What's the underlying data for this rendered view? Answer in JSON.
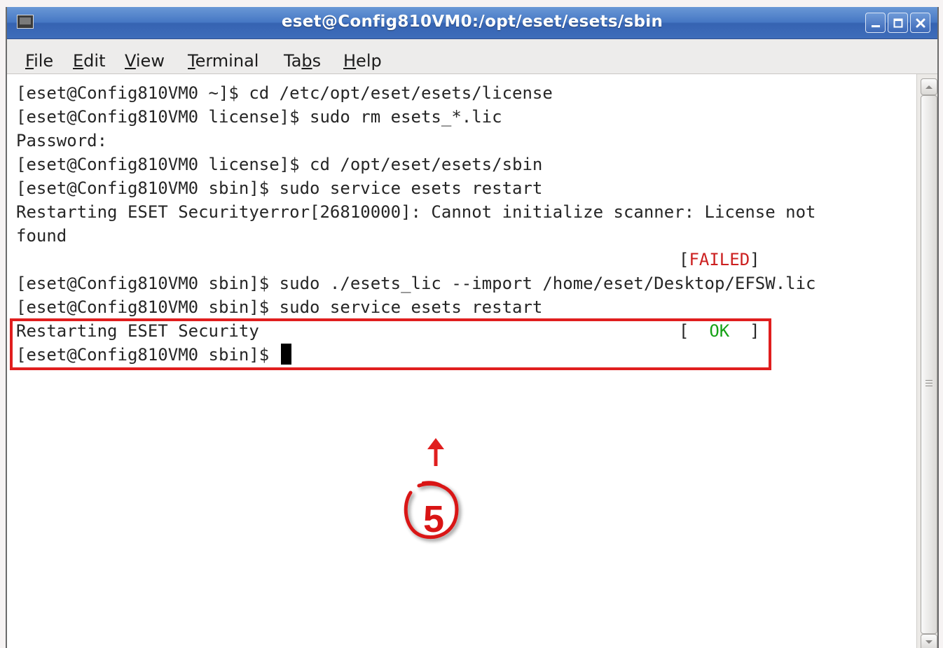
{
  "window": {
    "title": "eset@Config810VM0:/opt/eset/esets/sbin"
  },
  "menu": {
    "items": [
      {
        "label": "File"
      },
      {
        "label": "Edit"
      },
      {
        "label": "View"
      },
      {
        "label": "Terminal"
      },
      {
        "label": "Tabs"
      },
      {
        "label": "Help"
      }
    ]
  },
  "terminal": {
    "lines": [
      "[eset@Config810VM0 ~]$ cd /etc/opt/eset/esets/license",
      "[eset@Config810VM0 license]$ sudo rm esets_*.lic",
      "Password:",
      "[eset@Config810VM0 license]$ cd /opt/eset/esets/sbin",
      "[eset@Config810VM0 sbin]$ sudo service esets restart",
      "Restarting ESET Securityerror[26810000]: Cannot initialize scanner: License not",
      "found",
      "",
      "[eset@Config810VM0 sbin]$ sudo ./esets_lic --import /home/eset/Desktop/EFSW.lic",
      "[eset@Config810VM0 sbin]$ sudo service esets restart",
      "Restarting ESET Security",
      "[eset@Config810VM0 sbin]$ "
    ],
    "status_failed": {
      "open": "[",
      "text": "FAILED",
      "close": "]"
    },
    "status_ok": {
      "open": "[  ",
      "text": "OK",
      "close": "  ]"
    }
  },
  "annotation": {
    "step": "5"
  },
  "colors": {
    "title_bar": "#4678c4",
    "failed": "#cc2020",
    "ok": "#16a216",
    "highlight": "#e01e1e"
  }
}
